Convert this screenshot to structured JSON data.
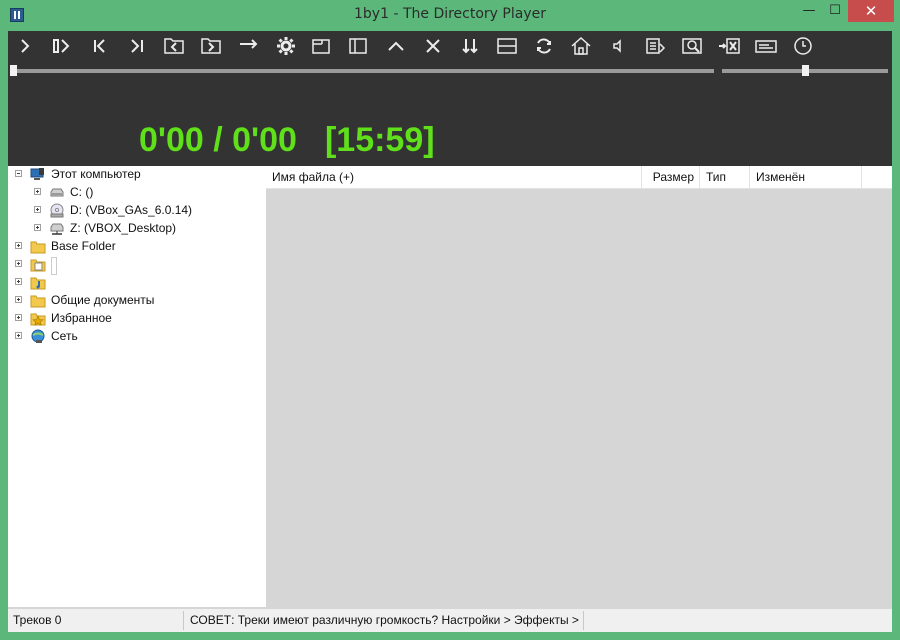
{
  "window": {
    "title": "1by1 - The Directory Player",
    "minimize_glyph": "—",
    "maximize_glyph": "☐",
    "close_glyph": "✕"
  },
  "toolbar": {
    "buttons": [
      {
        "name": "play-icon"
      },
      {
        "name": "pause-next-icon"
      },
      {
        "name": "previous-icon"
      },
      {
        "name": "next-icon"
      },
      {
        "name": "previous-folder-icon"
      },
      {
        "name": "next-folder-icon"
      },
      {
        "name": "arrow-right-icon"
      },
      {
        "name": "settings-gear-icon"
      },
      {
        "name": "window-compact-icon"
      },
      {
        "name": "sidebar-icon"
      },
      {
        "name": "chevron-up-icon"
      },
      {
        "name": "close-x-icon"
      },
      {
        "name": "down-arrows-icon"
      },
      {
        "name": "split-view-icon"
      },
      {
        "name": "refresh-icon"
      },
      {
        "name": "home-icon"
      },
      {
        "name": "volume-icon"
      },
      {
        "name": "playlist-icon"
      },
      {
        "name": "search-icon"
      },
      {
        "name": "remove-icon"
      },
      {
        "name": "keyboard-icon"
      },
      {
        "name": "clock-icon"
      }
    ]
  },
  "player": {
    "elapsed": "0'00 / 0'00",
    "total": "[15:59]",
    "seek_position": 0.0,
    "volume_level": 0.5,
    "time_color": "#5fe01a",
    "background_color": "#333333"
  },
  "tree": {
    "items": [
      {
        "label": "Этот компьютер",
        "icon": "computer-icon",
        "expander": "minus"
      },
      {
        "label": "C: ()",
        "icon": "drive-icon",
        "expander": "plus"
      },
      {
        "label": "D: (VBox_GAs_6.0.14)",
        "icon": "cd-drive-icon",
        "expander": "plus"
      },
      {
        "label": "Z: (VBOX_Desktop)",
        "icon": "network-drive-icon",
        "expander": "plus"
      },
      {
        "label": "Base Folder",
        "icon": "folder-icon",
        "expander": "plus"
      },
      {
        "label": "",
        "icon": "documents-folder-icon",
        "expander": "plus"
      },
      {
        "label": "",
        "icon": "music-folder-icon",
        "expander": "plus"
      },
      {
        "label": "Общие документы",
        "icon": "folder-icon",
        "expander": "plus"
      },
      {
        "label": "Избранное",
        "icon": "favorites-folder-icon",
        "expander": "plus"
      },
      {
        "label": "Сеть",
        "icon": "network-icon",
        "expander": "plus"
      }
    ]
  },
  "filelist": {
    "columns": [
      {
        "label": "Имя файла (+)"
      },
      {
        "label": "Размер"
      },
      {
        "label": "Тип"
      },
      {
        "label": "Изменён"
      }
    ]
  },
  "status": {
    "tracks": "Треков 0",
    "tip": "СОВЕТ: Треки имеют различную громкость? Настройки > Эффекты > ..."
  }
}
